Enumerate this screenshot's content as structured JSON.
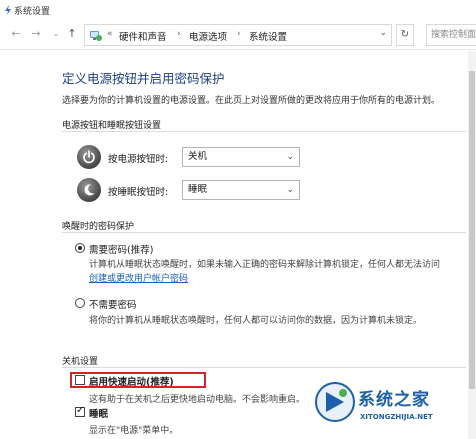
{
  "window": {
    "title": "系统设置"
  },
  "nav": {
    "back": "←",
    "forward": "→",
    "recent": "⌄",
    "up": "↑",
    "address_prefix": "«",
    "breadcrumb": [
      "硬件和声音",
      "电源选项",
      "系统设置"
    ],
    "separator": "›",
    "dropdown": "⌄",
    "refresh": "↻",
    "search_placeholder": "搜索控制面"
  },
  "page": {
    "title": "定义电源按钮并启用密码保护",
    "description": "选择要为你的计算机设置的电源设置。在此页上对设置所做的更改将应用于你所有的电源计划。"
  },
  "power_buttons": {
    "section_title": "电源按钮和睡眠按钮设置",
    "rows": [
      {
        "label": "按电源按钮时:",
        "value": "关机",
        "icon": "power-icon"
      },
      {
        "label": "按睡眠按钮时:",
        "value": "睡眠",
        "icon": "moon-icon"
      }
    ]
  },
  "wake_password": {
    "section_title": "唤醒时的密码保护",
    "require": {
      "label": "需要密码(推荐)",
      "desc": "计算机从睡眠状态唤醒时，如果未输入正确的密码来解除计算机锁定，任何人都无法访问",
      "link": "创建或更改用户帐户密码",
      "checked": true
    },
    "no_require": {
      "label": "不需要密码",
      "desc": "将你的计算机从睡眠状态唤醒时，任何人都可以访问你的数据，因为计算机未锁定。",
      "checked": false
    }
  },
  "shutdown": {
    "section_title": "关机设置",
    "fast_startup": {
      "label": "启用快速启动(推荐)",
      "desc": "这有助于在关机之后更快地启动电脑。不会影响重启。",
      "checked": false
    },
    "sleep": {
      "label": "睡眠",
      "desc": "显示在\"电源\"菜单中。",
      "checked": true
    }
  },
  "watermark": {
    "text": "系统之家",
    "url": "XITONGZHIJIA.NET"
  },
  "colors": {
    "title_blue": "#1e3f8a",
    "link_blue": "#1a5fb4",
    "highlight_red": "#d42424"
  }
}
